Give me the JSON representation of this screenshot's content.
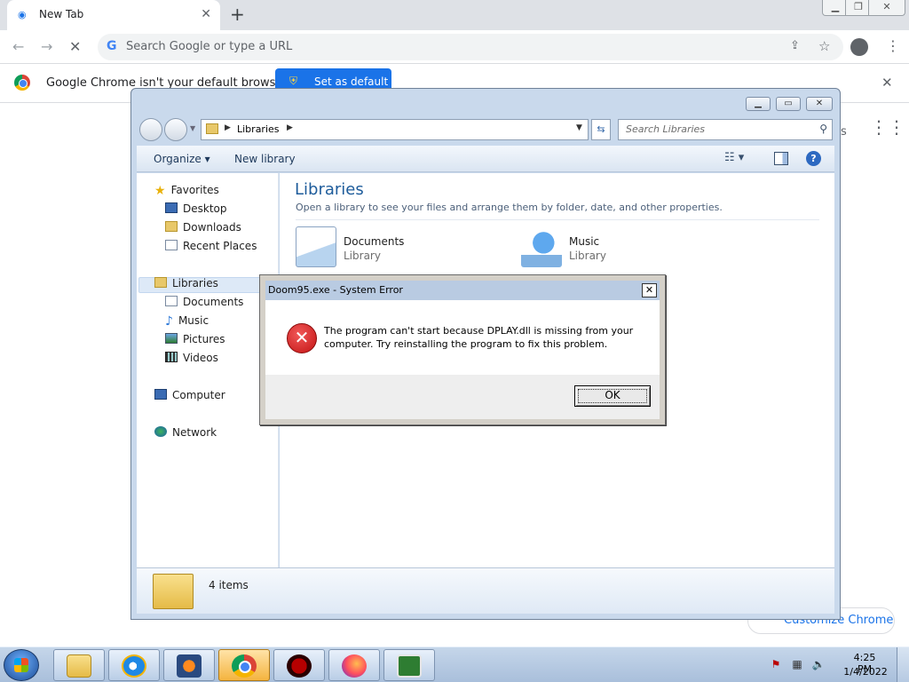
{
  "chrome": {
    "tab_title": "New Tab",
    "tab_favicon": "chrome-newtab-icon",
    "omnibox_placeholder": "Search Google or type a URL",
    "infobar_message": "Google Chrome isn't your default browser",
    "set_default_label": "Set as default",
    "ntp_partial_text": "s",
    "customize_label": "Customize Chrome",
    "accent_color": "#1a73e8"
  },
  "explorer": {
    "breadcrumb": "Libraries",
    "search_placeholder": "Search Libraries",
    "commands": {
      "organize": "Organize",
      "new_library": "New library"
    },
    "nav": {
      "favorites": "Favorites",
      "desktop": "Desktop",
      "downloads": "Downloads",
      "recent_places": "Recent Places",
      "libraries": "Libraries",
      "documents": "Documents",
      "music": "Music",
      "pictures": "Pictures",
      "videos": "Videos",
      "computer": "Computer",
      "network": "Network"
    },
    "content": {
      "title": "Libraries",
      "description": "Open a library to see your files and arrange them by folder, date, and other properties.",
      "items": [
        {
          "name": "Documents",
          "type": "Library"
        },
        {
          "name": "Music",
          "type": "Library"
        }
      ]
    },
    "status_count": "4 items"
  },
  "error_dialog": {
    "title": "Doom95.exe - System Error",
    "message_line1": "The program can't start because DPLAY.dll is missing from your",
    "message_line2": "computer. Try reinstalling the program to fix this problem.",
    "ok_label": "OK",
    "icon": "error-icon"
  },
  "taskbar": {
    "apps": [
      "windows-explorer",
      "internet-explorer",
      "windows-media-player",
      "google-chrome",
      "doom95",
      "firefox",
      "command-prompt"
    ],
    "time": "4:25 PM",
    "date": "1/4/2022"
  }
}
